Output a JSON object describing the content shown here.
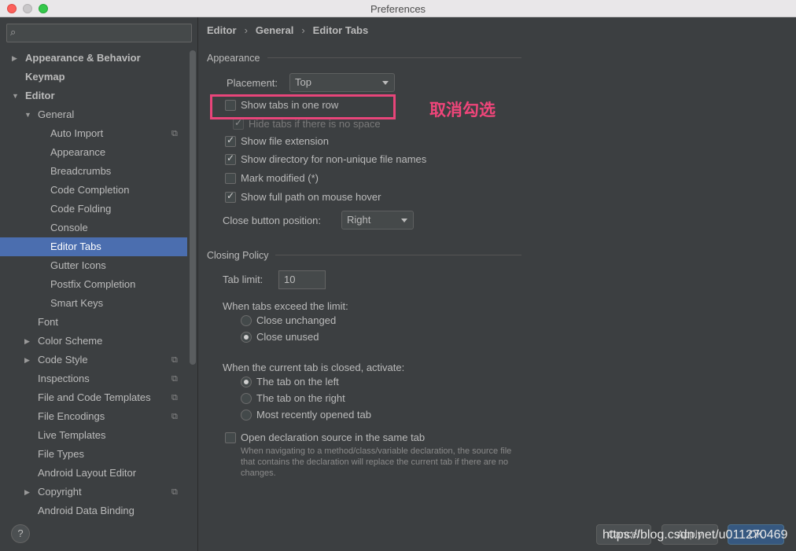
{
  "window": {
    "title": "Preferences"
  },
  "search": {
    "placeholder": ""
  },
  "sidebar": {
    "items": [
      {
        "label": "Appearance & Behavior",
        "arrow": "▶"
      },
      {
        "label": "Keymap"
      },
      {
        "label": "Editor",
        "arrow": "▼"
      },
      {
        "label": "General",
        "arrow": "▼"
      },
      {
        "label": "Auto Import"
      },
      {
        "label": "Appearance"
      },
      {
        "label": "Breadcrumbs"
      },
      {
        "label": "Code Completion"
      },
      {
        "label": "Code Folding"
      },
      {
        "label": "Console"
      },
      {
        "label": "Editor Tabs"
      },
      {
        "label": "Gutter Icons"
      },
      {
        "label": "Postfix Completion"
      },
      {
        "label": "Smart Keys"
      },
      {
        "label": "Font"
      },
      {
        "label": "Color Scheme",
        "arrow": "▶"
      },
      {
        "label": "Code Style",
        "arrow": "▶"
      },
      {
        "label": "Inspections"
      },
      {
        "label": "File and Code Templates"
      },
      {
        "label": "File Encodings"
      },
      {
        "label": "Live Templates"
      },
      {
        "label": "File Types"
      },
      {
        "label": "Android Layout Editor"
      },
      {
        "label": "Copyright",
        "arrow": "▶"
      },
      {
        "label": "Android Data Binding"
      }
    ]
  },
  "breadcrumb": {
    "part1": "Editor",
    "part2": "General",
    "part3": "Editor Tabs",
    "sep": "›"
  },
  "appearance": {
    "section_title": "Appearance",
    "placement_label": "Placement:",
    "placement_value": "Top",
    "show_tabs_one_row": "Show tabs in one row",
    "hide_tabs_no_space": "Hide tabs if there is no space",
    "show_file_extension": "Show file extension",
    "show_directory": "Show directory for non-unique file names",
    "mark_modified": "Mark modified (*)",
    "show_full_path": "Show full path on mouse hover",
    "close_button_label": "Close button position:",
    "close_button_value": "Right"
  },
  "closing_policy": {
    "section_title": "Closing Policy",
    "tab_limit_label": "Tab limit:",
    "tab_limit_value": "10",
    "exceed_label": "When tabs exceed the limit:",
    "close_unchanged": "Close unchanged",
    "close_unused": "Close unused",
    "activate_label": "When the current tab is closed, activate:",
    "tab_left": "The tab on the left",
    "tab_right": "The tab on the right",
    "most_recent": "Most recently opened tab",
    "open_decl": "Open declaration source in the same tab",
    "open_decl_desc": "When navigating to a method/class/variable declaration, the source file that contains the declaration will replace the current tab if there are no changes."
  },
  "annotation": {
    "text": "取消勾选"
  },
  "footer": {
    "help": "?",
    "cancel": "Cancel",
    "apply": "Apply",
    "ok": "OK",
    "watermark": "https://blog.csdn.net/u011270469"
  },
  "colors": {
    "accent": "#4b6eaf",
    "highlight": "#e8457a",
    "background": "#3c3f41"
  },
  "icons": {
    "search": "search-icon",
    "copy": "copy-settings-icon"
  }
}
